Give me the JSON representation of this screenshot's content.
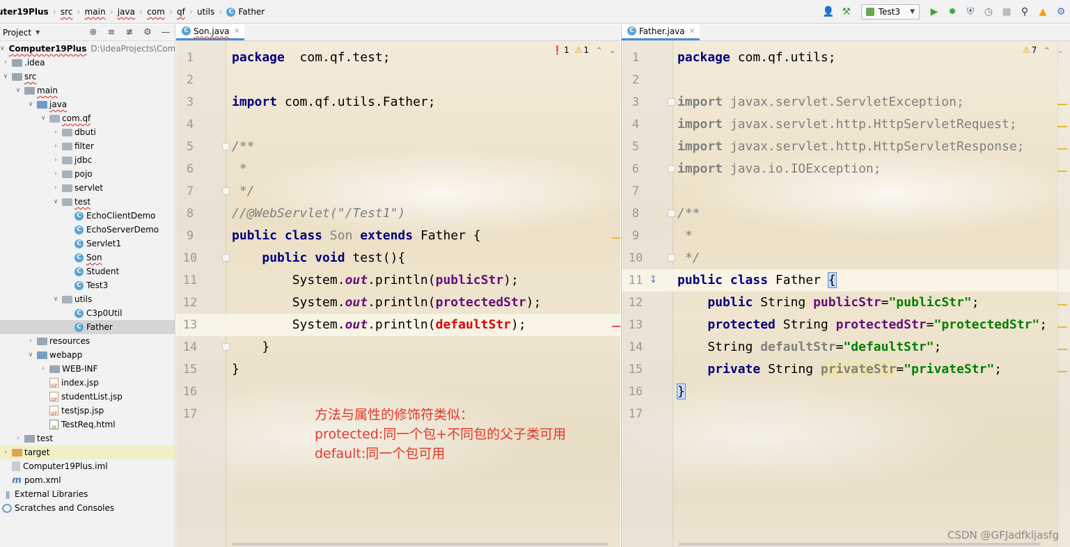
{
  "breadcrumbs": [
    {
      "label": "uter19Plus",
      "root": true
    },
    {
      "label": "src",
      "squig": true
    },
    {
      "label": "main",
      "squig": true
    },
    {
      "label": "java",
      "squig": true
    },
    {
      "label": "com",
      "squig": true
    },
    {
      "label": "qf",
      "squig": true
    },
    {
      "label": "utils",
      "squig": false
    },
    {
      "label": "Father",
      "squig": false,
      "class_icon": true
    }
  ],
  "toolbar": {
    "run_config": "Test3",
    "icons": [
      "user-icon",
      "build-hammer-icon",
      "run-icon",
      "debug-icon",
      "coverage-icon",
      "profile-icon",
      "stop-icon",
      "search-icon",
      "update-icon",
      "settings-icon"
    ]
  },
  "project_panel": {
    "title": "Project",
    "tree": [
      {
        "label": "Computer19Plus",
        "path": "D:\\IdeaProjects\\Comp",
        "indent": 0,
        "toggle": "open",
        "icon": "folder",
        "bold": true,
        "squig": true
      },
      {
        "label": ".idea",
        "indent": 0,
        "toggle": "closed",
        "icon": "folder"
      },
      {
        "label": "src",
        "indent": 0,
        "toggle": "open",
        "icon": "folder",
        "squig": true
      },
      {
        "label": "main",
        "indent": 1,
        "toggle": "open",
        "icon": "folder",
        "squig": true
      },
      {
        "label": "java",
        "indent": 2,
        "toggle": "open",
        "icon": "src",
        "squig": true
      },
      {
        "label": "com.qf",
        "indent": 3,
        "toggle": "open",
        "icon": "pkg",
        "squig": true
      },
      {
        "label": "dbuti",
        "indent": 4,
        "toggle": "closed",
        "icon": "pkg"
      },
      {
        "label": "filter",
        "indent": 4,
        "toggle": "closed",
        "icon": "pkg"
      },
      {
        "label": "jdbc",
        "indent": 4,
        "toggle": "closed",
        "icon": "pkg"
      },
      {
        "label": "pojo",
        "indent": 4,
        "toggle": "closed",
        "icon": "pkg"
      },
      {
        "label": "servlet",
        "indent": 4,
        "toggle": "closed",
        "icon": "pkg"
      },
      {
        "label": "test",
        "indent": 4,
        "toggle": "open",
        "icon": "pkg",
        "squig": true
      },
      {
        "label": "EchoClientDemo",
        "indent": 5,
        "icon": "class"
      },
      {
        "label": "EchoServerDemo",
        "indent": 5,
        "icon": "class"
      },
      {
        "label": "Servlet1",
        "indent": 5,
        "icon": "class"
      },
      {
        "label": "Son",
        "indent": 5,
        "icon": "class",
        "squig": true
      },
      {
        "label": "Student",
        "indent": 5,
        "icon": "class"
      },
      {
        "label": "Test3",
        "indent": 5,
        "icon": "class"
      },
      {
        "label": "utils",
        "indent": 4,
        "toggle": "open",
        "icon": "pkg"
      },
      {
        "label": "C3p0Util",
        "indent": 5,
        "icon": "class"
      },
      {
        "label": "Father",
        "indent": 5,
        "icon": "class",
        "selected": true
      },
      {
        "label": "resources",
        "indent": 2,
        "toggle": "closed",
        "icon": "res"
      },
      {
        "label": "webapp",
        "indent": 2,
        "toggle": "open",
        "icon": "web"
      },
      {
        "label": "WEB-INF",
        "indent": 3,
        "toggle": "closed",
        "icon": "folder"
      },
      {
        "label": "index.jsp",
        "indent": 3,
        "icon": "jsp"
      },
      {
        "label": "studentList.jsp",
        "indent": 3,
        "icon": "jsp"
      },
      {
        "label": "testjsp.jsp",
        "indent": 3,
        "icon": "jsp"
      },
      {
        "label": "TestReq.html",
        "indent": 3,
        "icon": "html"
      },
      {
        "label": "test",
        "indent": 1,
        "toggle": "closed",
        "icon": "folder"
      },
      {
        "label": "target",
        "indent": 0,
        "toggle": "closed",
        "icon": "tgt",
        "highlight": true
      },
      {
        "label": "Computer19Plus.iml",
        "indent": 0,
        "icon": "iml"
      },
      {
        "label": "pom.xml",
        "indent": 0,
        "icon": "maven"
      },
      {
        "label": "External Libraries",
        "indent": -1,
        "toggle": "closed",
        "icon": "lib"
      },
      {
        "label": "Scratches and Consoles",
        "indent": -1,
        "icon": "scratch"
      }
    ]
  },
  "left_editor": {
    "tab_label": "Son.java",
    "inspections": {
      "errors": "1",
      "warnings": "1"
    },
    "current_line": 13,
    "lines": [
      {
        "n": "1",
        "tokens": [
          [
            "kw",
            "package"
          ],
          [
            "",
            "  com.qf.test;"
          ]
        ]
      },
      {
        "n": "2",
        "tokens": []
      },
      {
        "n": "3",
        "tokens": [
          [
            "kw",
            "import"
          ],
          [
            "",
            " com.qf.utils.Father;"
          ]
        ]
      },
      {
        "n": "4",
        "tokens": []
      },
      {
        "n": "5",
        "tokens": [
          [
            "cm",
            "/**"
          ]
        ],
        "fold": true
      },
      {
        "n": "6",
        "tokens": [
          [
            "cm",
            " *"
          ]
        ]
      },
      {
        "n": "7",
        "tokens": [
          [
            "cm",
            " */"
          ]
        ],
        "fold": true
      },
      {
        "n": "8",
        "tokens": [
          [
            "cm",
            "//@WebServlet(\"/Test1\")"
          ]
        ]
      },
      {
        "n": "9",
        "tokens": [
          [
            "kw",
            "public class "
          ],
          [
            "un",
            "Son"
          ],
          [
            "kw",
            " extends "
          ],
          [
            "",
            "Father {"
          ]
        ]
      },
      {
        "n": "10",
        "tokens": [
          [
            "",
            "    "
          ],
          [
            "kw",
            "public void "
          ],
          [
            "",
            "test(){"
          ]
        ],
        "fold": true
      },
      {
        "n": "11",
        "tokens": [
          [
            "",
            "        System."
          ],
          [
            "st",
            "out"
          ],
          [
            "",
            ".println("
          ],
          [
            "fld",
            "publicStr"
          ],
          [
            "",
            ");"
          ]
        ]
      },
      {
        "n": "12",
        "tokens": [
          [
            "",
            "        System."
          ],
          [
            "st",
            "out"
          ],
          [
            "",
            ".println("
          ],
          [
            "fld",
            "protectedStr"
          ],
          [
            "",
            ");"
          ]
        ]
      },
      {
        "n": "13",
        "tokens": [
          [
            "",
            "        System."
          ],
          [
            "st",
            "out"
          ],
          [
            "",
            ".println("
          ],
          [
            "err",
            "defaultStr"
          ],
          [
            "",
            ");"
          ]
        ]
      },
      {
        "n": "14",
        "tokens": [
          [
            "",
            "    }"
          ]
        ],
        "fold": true
      },
      {
        "n": "15",
        "tokens": [
          [
            "",
            "}"
          ]
        ]
      },
      {
        "n": "16",
        "tokens": []
      },
      {
        "n": "17",
        "tokens": []
      }
    ],
    "annotation": [
      "方法与属性的修饰符类似：",
      "protected:同一个包+不同包的父子类可用",
      "default:同一个包可用"
    ]
  },
  "right_editor": {
    "tab_label": "Father.java",
    "inspections": {
      "warnings": "7"
    },
    "current_line": 11,
    "lines": [
      {
        "n": "1",
        "tokens": [
          [
            "kw",
            "package"
          ],
          [
            "",
            " com.qf.utils;"
          ]
        ]
      },
      {
        "n": "2",
        "tokens": []
      },
      {
        "n": "3",
        "tokens": [
          [
            "kw un",
            "import"
          ],
          [
            "un",
            " javax.servlet.ServletException;"
          ]
        ],
        "fold": true
      },
      {
        "n": "4",
        "tokens": [
          [
            "kw un",
            "import"
          ],
          [
            "un",
            " javax.servlet.http.HttpServletRequest;"
          ]
        ]
      },
      {
        "n": "5",
        "tokens": [
          [
            "kw un",
            "import"
          ],
          [
            "un",
            " javax.servlet.http.HttpServletResponse;"
          ]
        ]
      },
      {
        "n": "6",
        "tokens": [
          [
            "kw un",
            "import"
          ],
          [
            "un",
            " java.io.IOException;"
          ]
        ],
        "fold": true
      },
      {
        "n": "7",
        "tokens": []
      },
      {
        "n": "8",
        "tokens": [
          [
            "cm",
            "/**"
          ]
        ],
        "fold": true
      },
      {
        "n": "9",
        "tokens": [
          [
            "cm",
            " *"
          ]
        ]
      },
      {
        "n": "10",
        "tokens": [
          [
            "cm",
            " */"
          ]
        ],
        "fold": true
      },
      {
        "n": "11",
        "tokens": [
          [
            "kw",
            "public class "
          ],
          [
            "",
            "Father "
          ],
          [
            "caretbox",
            "{"
          ]
        ]
      },
      {
        "n": "12",
        "tokens": [
          [
            "",
            "    "
          ],
          [
            "kw",
            "public "
          ],
          [
            "",
            "String "
          ],
          [
            "fld",
            "publicStr"
          ],
          [
            "",
            "="
          ],
          [
            "str",
            "\"publicStr\""
          ],
          [
            "",
            ";"
          ]
        ]
      },
      {
        "n": "13",
        "tokens": [
          [
            "",
            "    "
          ],
          [
            "kw",
            "protected "
          ],
          [
            "",
            "String "
          ],
          [
            "fld",
            "protectedStr"
          ],
          [
            "",
            "="
          ],
          [
            "str",
            "\"protectedStr\""
          ],
          [
            "",
            ";"
          ]
        ]
      },
      {
        "n": "14",
        "tokens": [
          [
            "",
            "    String "
          ],
          [
            "fld un",
            "defaultStr"
          ],
          [
            "",
            "="
          ],
          [
            "str",
            "\"defaultStr\""
          ],
          [
            "",
            ";"
          ]
        ]
      },
      {
        "n": "15",
        "tokens": [
          [
            "",
            "    "
          ],
          [
            "kw",
            "private "
          ],
          [
            "",
            "String "
          ],
          [
            "fld un hl",
            "privateStr"
          ],
          [
            "",
            "="
          ],
          [
            "str",
            "\"privateStr\""
          ],
          [
            "",
            ";"
          ]
        ]
      },
      {
        "n": "16",
        "tokens": [
          [
            "caretbox",
            "}"
          ]
        ]
      },
      {
        "n": "17",
        "tokens": []
      }
    ]
  },
  "watermark": "CSDN @GFJadfkljasfg"
}
